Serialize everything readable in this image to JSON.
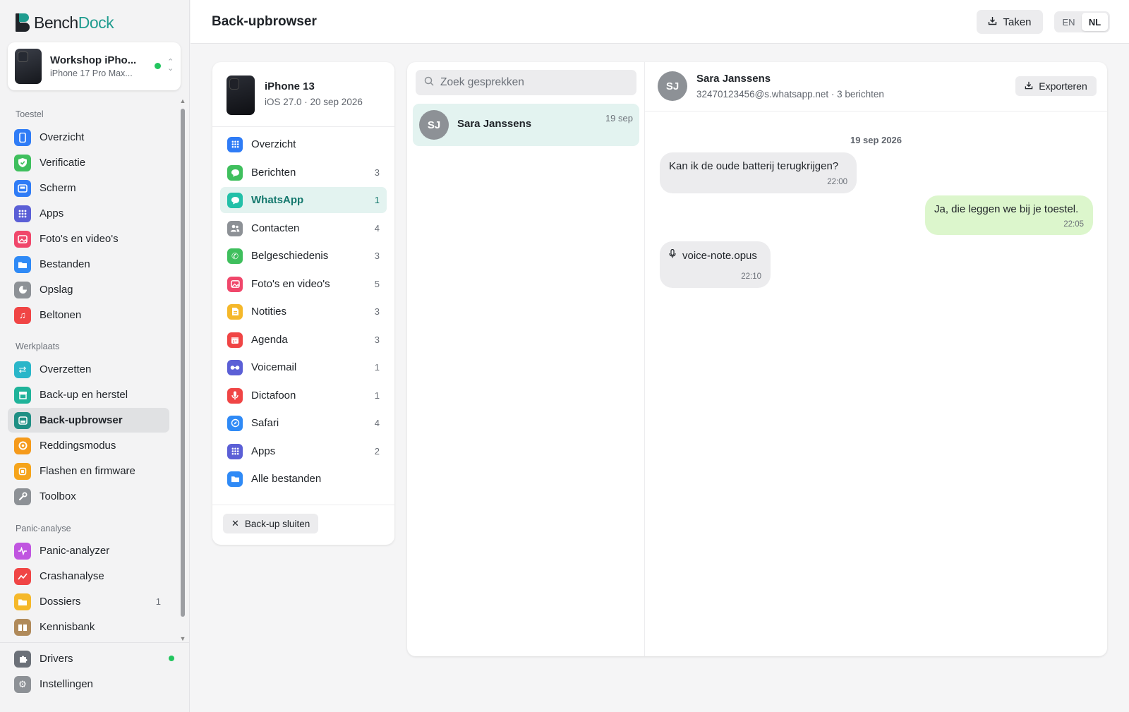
{
  "app": {
    "brand_part1": "Bench",
    "brand_part2": "Dock",
    "accent_color": "#1f9c8f"
  },
  "device": {
    "name": "Workshop iPho...",
    "model": "iPhone 17 Pro Max...",
    "status": "connected"
  },
  "sidebar": {
    "sections": [
      {
        "title": "Toestel",
        "items": [
          {
            "label": "Overzicht",
            "icon": "phone-icon",
            "color": "#2f7cf6"
          },
          {
            "label": "Verificatie",
            "icon": "shield-check-icon",
            "color": "#3fbf5d"
          },
          {
            "label": "Scherm",
            "icon": "screen-icon",
            "color": "#2f7cf6"
          },
          {
            "label": "Apps",
            "icon": "grid-icon",
            "color": "#5b5fd6"
          },
          {
            "label": "Foto's en video's",
            "icon": "photo-icon",
            "color": "#f0476b"
          },
          {
            "label": "Bestanden",
            "icon": "folder-icon",
            "color": "#2f8af6"
          },
          {
            "label": "Opslag",
            "icon": "pie-icon",
            "color": "#8d9196"
          },
          {
            "label": "Beltonen",
            "icon": "music-icon",
            "color": "#f04545"
          }
        ]
      },
      {
        "title": "Werkplaats",
        "items": [
          {
            "label": "Overzetten",
            "icon": "transfer-icon",
            "color": "#2ab6c9"
          },
          {
            "label": "Back-up en herstel",
            "icon": "archive-icon",
            "color": "#1fb39a"
          },
          {
            "label": "Back-upbrowser",
            "icon": "backup-browser-icon",
            "color": "#1f8f84",
            "active": true
          },
          {
            "label": "Reddingsmodus",
            "icon": "lifebuoy-icon",
            "color": "#f59a1b"
          },
          {
            "label": "Flashen en firmware",
            "icon": "chip-icon",
            "color": "#f5a41b"
          },
          {
            "label": "Toolbox",
            "icon": "wrench-icon",
            "color": "#8d9196"
          }
        ]
      },
      {
        "title": "Panic-analyse",
        "items": [
          {
            "label": "Panic-analyzer",
            "icon": "pulse-icon",
            "color": "#c055e0"
          },
          {
            "label": "Crashanalyse",
            "icon": "chart-icon",
            "color": "#f04545"
          },
          {
            "label": "Dossiers",
            "icon": "folder-icon",
            "color": "#f5b82a",
            "count": "1"
          },
          {
            "label": "Kennisbank",
            "icon": "book-icon",
            "color": "#b08a5a"
          }
        ]
      }
    ],
    "bottom": [
      {
        "label": "Drivers",
        "icon": "puzzle-icon",
        "color": "#6b7078",
        "status": "ok"
      },
      {
        "label": "Instellingen",
        "icon": "gear-icon",
        "color": "#8d9196"
      }
    ]
  },
  "topbar": {
    "title": "Back-upbrowser",
    "tasks_label": "Taken",
    "lang_en": "EN",
    "lang_nl": "NL",
    "active_lang": "NL"
  },
  "backup": {
    "device_name": "iPhone 13",
    "device_sub": "iOS 27.0 · 20 sep 2026",
    "close_label": "Back-up sluiten",
    "categories": [
      {
        "label": "Overzicht",
        "count": "",
        "icon": "grid-icon",
        "color": "#2f7cf6"
      },
      {
        "label": "Berichten",
        "count": "3",
        "icon": "message-icon",
        "color": "#3fbf5d"
      },
      {
        "label": "WhatsApp",
        "count": "1",
        "icon": "whatsapp-icon",
        "color": "#22c0a8",
        "active": true
      },
      {
        "label": "Contacten",
        "count": "4",
        "icon": "contacts-icon",
        "color": "#8d9196"
      },
      {
        "label": "Belgeschiedenis",
        "count": "3",
        "icon": "phone-call-icon",
        "color": "#3fbf5d"
      },
      {
        "label": "Foto's en video's",
        "count": "5",
        "icon": "photo-icon",
        "color": "#f0476b"
      },
      {
        "label": "Notities",
        "count": "3",
        "icon": "note-icon",
        "color": "#f5b82a"
      },
      {
        "label": "Agenda",
        "count": "3",
        "icon": "calendar-icon",
        "color": "#f04545"
      },
      {
        "label": "Voicemail",
        "count": "1",
        "icon": "voicemail-icon",
        "color": "#5b5fd6"
      },
      {
        "label": "Dictafoon",
        "count": "1",
        "icon": "mic-icon",
        "color": "#f04545"
      },
      {
        "label": "Safari",
        "count": "4",
        "icon": "compass-icon",
        "color": "#2f8af6"
      },
      {
        "label": "Apps",
        "count": "2",
        "icon": "grid-icon",
        "color": "#5b5fd6"
      },
      {
        "label": "Alle bestanden",
        "count": "",
        "icon": "folder-icon",
        "color": "#2f8af6"
      }
    ]
  },
  "conversations": {
    "search_placeholder": "Zoek gesprekken",
    "items": [
      {
        "initials": "SJ",
        "name": "Sara Janssens",
        "date": "19 sep"
      }
    ]
  },
  "chat": {
    "initials": "SJ",
    "name": "Sara Janssens",
    "meta": "32470123456@s.whatsapp.net · 3 berichten",
    "export_label": "Exporteren",
    "date_separator": "19 sep 2026",
    "messages": [
      {
        "direction": "in",
        "text": "Kan ik de oude batterij terugkrijgen?",
        "time": "22:00"
      },
      {
        "direction": "out",
        "text": "Ja, die leggen we bij je toestel.",
        "time": "22:05"
      },
      {
        "direction": "in",
        "text": "voice-note.opus",
        "time": "22:10",
        "attachment": "mic-icon"
      }
    ]
  }
}
